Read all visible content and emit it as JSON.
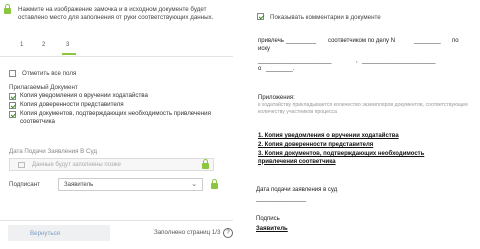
{
  "left": {
    "notice": "Нажмите на изображение замочка и в исходном документе будет оставлено место для заполнения от руки соответствующих данных.",
    "steps": [
      {
        "label": "1"
      },
      {
        "label": "2"
      },
      {
        "label": "3"
      }
    ],
    "check_all_label": "Отметить все поля",
    "attached_title": "Прилагаемый Документ",
    "attached_items": [
      "Копия уведомления о вручении ходатайства",
      "Копия доверенности представителя",
      "Копия документов, подтверждающих необходимость привлечения соответчика"
    ],
    "date_label": "Дата Подачи Заявления В Суд",
    "date_placeholder": "Данные будут заполнены позже",
    "signer_label": "Подписант",
    "signer_value": "Заявитель",
    "help_symbol": "?",
    "back_button": "Вернуться",
    "pager": "Заполнено страниц 1/3"
  },
  "right": {
    "show_comments_label": "Показывать комментарии в документе",
    "line1_a": "привлечь",
    "line1_b": "соответчиком по делу N",
    "line1_c": "по",
    "line2": "иску",
    "line3_sep": ",",
    "line4": "о",
    "attachments_title": "Приложения:",
    "attachments_note": "к ходатайству прикладывается количество экземпляров документов, соответствующее количеству участников процесса",
    "attachments_list": [
      "1. Копия уведомления о вручении ходатайства",
      "2. Копия доверенности представителя",
      "3. Копия документов, подтверждающих необходимость привлечения соответчика"
    ],
    "date_title": "Дата подачи заявления в суд",
    "sign_title": "Подпись",
    "sign_value": "Заявитель"
  },
  "colors": {
    "accent_green": "#8cc63f",
    "check_green": "#3a8a1f",
    "back_text": "#7a9dc2"
  }
}
